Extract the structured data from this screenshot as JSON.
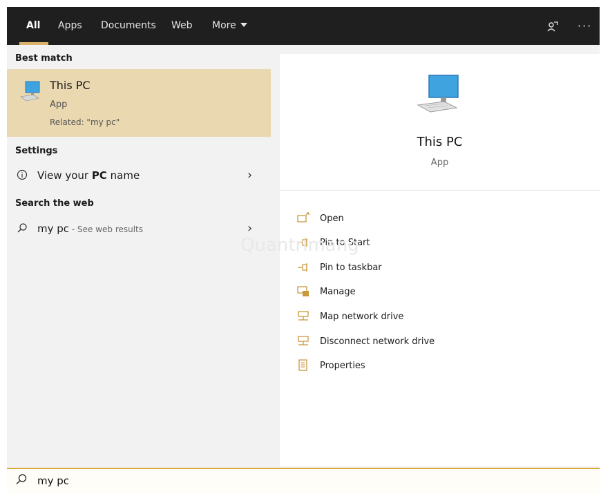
{
  "tabs": [
    {
      "label": "All",
      "active": true
    },
    {
      "label": "Apps"
    },
    {
      "label": "Documents"
    },
    {
      "label": "Web"
    },
    {
      "label": "More"
    }
  ],
  "top_icons": {
    "feedback": "feedback-icon",
    "more": "···"
  },
  "sections": {
    "best_match": "Best match",
    "settings": "Settings",
    "search_web": "Search the web"
  },
  "best_match": {
    "title": "This PC",
    "type": "App",
    "related": "Related: \"my pc\""
  },
  "settings_item": {
    "prefix": "View your ",
    "bold": "PC",
    "suffix": " name"
  },
  "web_item": {
    "query": "my pc",
    "sub": " - See web results"
  },
  "detail": {
    "title": "This PC",
    "type": "App",
    "actions": [
      {
        "label": "Open",
        "icon": "open-icon"
      },
      {
        "label": "Pin to Start",
        "icon": "pin-icon"
      },
      {
        "label": "Pin to taskbar",
        "icon": "pin-icon"
      },
      {
        "label": "Manage",
        "icon": "manage-icon"
      },
      {
        "label": "Map network drive",
        "icon": "network-drive-icon"
      },
      {
        "label": "Disconnect network drive",
        "icon": "network-drive-icon"
      },
      {
        "label": "Properties",
        "icon": "properties-icon"
      }
    ]
  },
  "search": {
    "value": "my pc"
  },
  "watermark": "Quantrimang",
  "colors": {
    "accent": "#d9a93a",
    "highlight": "#e9d8b0",
    "topbar": "#1f1f1f"
  }
}
